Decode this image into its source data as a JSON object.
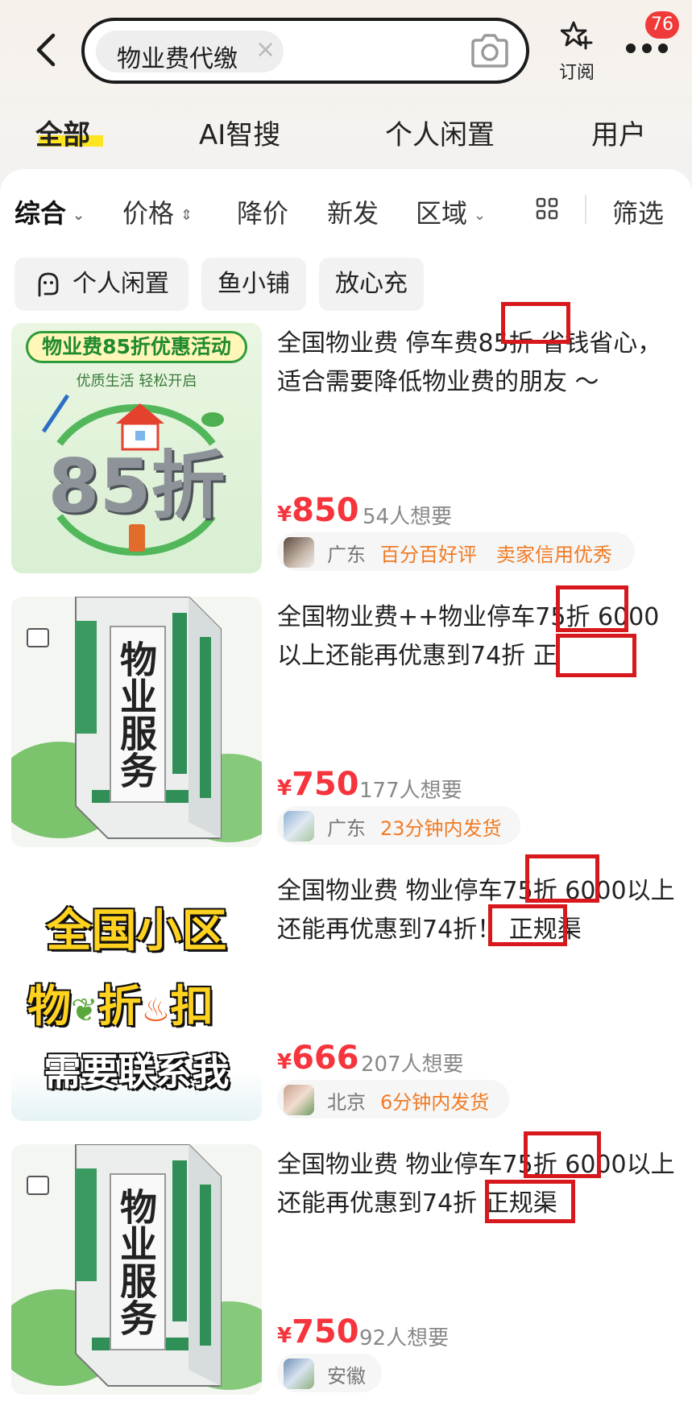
{
  "search": {
    "query": "物业费代缴",
    "clear": "×"
  },
  "header": {
    "subscribe_label": "订阅",
    "badge_count": "76"
  },
  "tabs": [
    {
      "label": "全部",
      "active": true
    },
    {
      "label": "AI智搜",
      "active": false
    },
    {
      "label": "个人闲置",
      "active": false
    },
    {
      "label": "用户",
      "active": false
    }
  ],
  "filters": {
    "items": [
      "综合",
      "价格",
      "降价",
      "新发",
      "区域"
    ],
    "screen": "筛选"
  },
  "quick_chips": [
    "个人闲置",
    "鱼小铺",
    "放心充"
  ],
  "currency": "¥",
  "items": [
    {
      "title": "全国物业费 停车费85折  省钱省心，适合需要降低物业费的朋友 ～",
      "price": "850",
      "wants": "54人想要",
      "location": "广东",
      "tags": [
        "百分百好评",
        "卖家信用优秀"
      ],
      "thumb": {
        "banner": "物业费85折优惠活动",
        "sub": "优质生活 轻松开启",
        "big": "85折"
      }
    },
    {
      "title": "全国物业费++物业停车75折  6000以上还能再优惠到74折   正",
      "price": "750",
      "wants": "177人想要",
      "location": "广东",
      "tags": [
        "23分钟内发货"
      ],
      "thumb": {
        "sign": "物业服务"
      }
    },
    {
      "title": "全国物业费  物业停车75折   6000以上还能再优惠到74折！ 正规渠",
      "price": "666",
      "wants": "207人想要",
      "location": "北京",
      "tags": [
        "6分钟内发货"
      ],
      "thumb": {
        "line1": "全国小区",
        "line2a": "物",
        "line2b": "折",
        "line2c": "扣",
        "line3": "需要联系我"
      }
    },
    {
      "title": "全国物业费  物业停车75折   6000以上还能再优惠到74折   正规渠",
      "price": "750",
      "wants": "92人想要",
      "location": "安徽",
      "tags": [],
      "thumb": {
        "sign": "物业服务"
      }
    }
  ],
  "colors": {
    "accent_red": "#f5343c",
    "tag_orange": "#f07b24",
    "tab_highlight": "#ffe420",
    "annotation_box": "#d7191d"
  }
}
